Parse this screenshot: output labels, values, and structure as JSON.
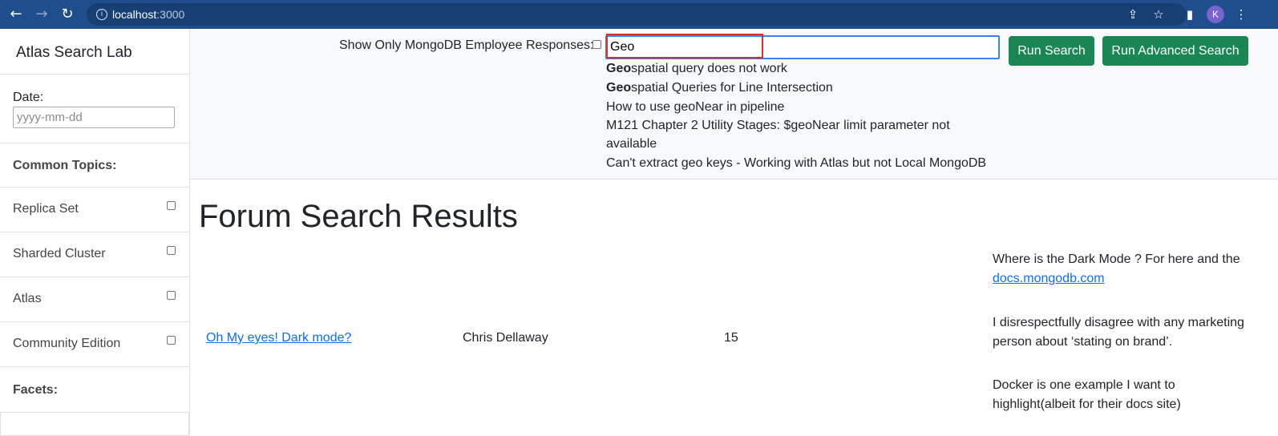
{
  "browser": {
    "url_host": "localhost",
    "url_port": ":3000",
    "avatar_initial": "K"
  },
  "sidebar": {
    "brand": "Atlas Search Lab",
    "date_label": "Date:",
    "date_placeholder": "yyyy-mm-dd",
    "common_topics_heading": "Common Topics:",
    "topics": [
      "Replica Set",
      "Sharded Cluster",
      "Atlas",
      "Community Edition"
    ],
    "facets_heading": "Facets:"
  },
  "search": {
    "employee_label": "Show Only MongoDB Employee Responses:",
    "query": "Geo",
    "run_label": "Run Search",
    "advanced_label": "Run Advanced Search",
    "suggestions": [
      {
        "bold": "Geo",
        "rest": "spatial query does not work"
      },
      {
        "bold": "Geo",
        "rest": "spatial Queries for Line Intersection"
      },
      {
        "bold": "",
        "rest": "How to use geoNear in pipeline"
      },
      {
        "bold": "",
        "rest": "M121 Chapter 2 Utility Stages: $geoNear limit parameter not available"
      },
      {
        "bold": "",
        "rest": "Can't extract geo keys - Working with Atlas but not Local MongoDB"
      }
    ]
  },
  "results": {
    "title": "Forum Search Results",
    "rows": [
      {
        "title": "Oh My eyes! Dark mode?",
        "author": "Chris Dellaway",
        "count": "15",
        "replies": [
          {
            "text": "Where is the Dark Mode ? For here and the ",
            "link": "docs.mongodb.com"
          },
          {
            "text": "I disrespectfully disagree with any marketing person about ‘stating on brand’.",
            "link": ""
          },
          {
            "text": "Docker is one example I want to highlight(albeit for their docs site)",
            "link": ""
          }
        ]
      }
    ]
  },
  "colors": {
    "chrome": "#1f4e8c",
    "button_green": "#198754",
    "link_blue": "#0d6efd",
    "focus_blue": "#3b82f6",
    "annotation_red": "#d9302c"
  }
}
